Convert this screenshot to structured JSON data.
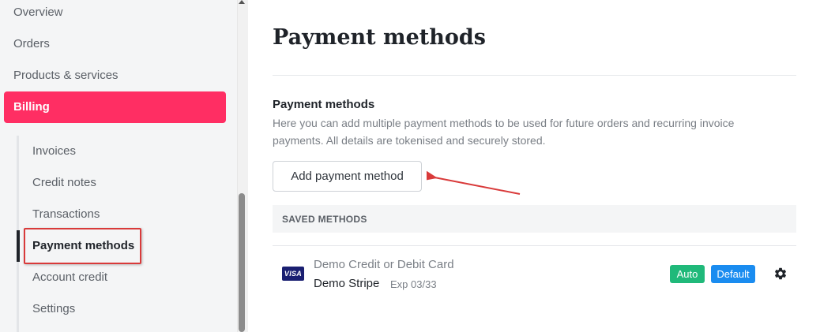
{
  "sidebar": {
    "items": [
      {
        "label": "Overview"
      },
      {
        "label": "Orders"
      },
      {
        "label": "Products & services"
      },
      {
        "label": "Billing"
      }
    ],
    "subitems": [
      {
        "label": "Invoices"
      },
      {
        "label": "Credit notes"
      },
      {
        "label": "Transactions"
      },
      {
        "label": "Payment methods"
      },
      {
        "label": "Account credit"
      },
      {
        "label": "Settings"
      }
    ]
  },
  "main": {
    "title": "Payment methods",
    "section_title": "Payment methods",
    "section_description": "Here you can add multiple payment methods to be used for future orders and recurring invoice payments. All details are tokenised and securely stored.",
    "add_button_label": "Add payment method",
    "saved_header": "SAVED METHODS",
    "methods": [
      {
        "brand": "VISA",
        "type": "Demo Credit or Debit Card",
        "name": "Demo Stripe",
        "expiry": "Exp 03/33",
        "badges": [
          "Auto",
          "Default"
        ],
        "icon": "gear-icon"
      }
    ]
  },
  "colors": {
    "accent": "#ff2e63",
    "badge_auto": "#20b97a",
    "badge_default": "#1a8cf0",
    "annotation": "#d93a3a"
  }
}
